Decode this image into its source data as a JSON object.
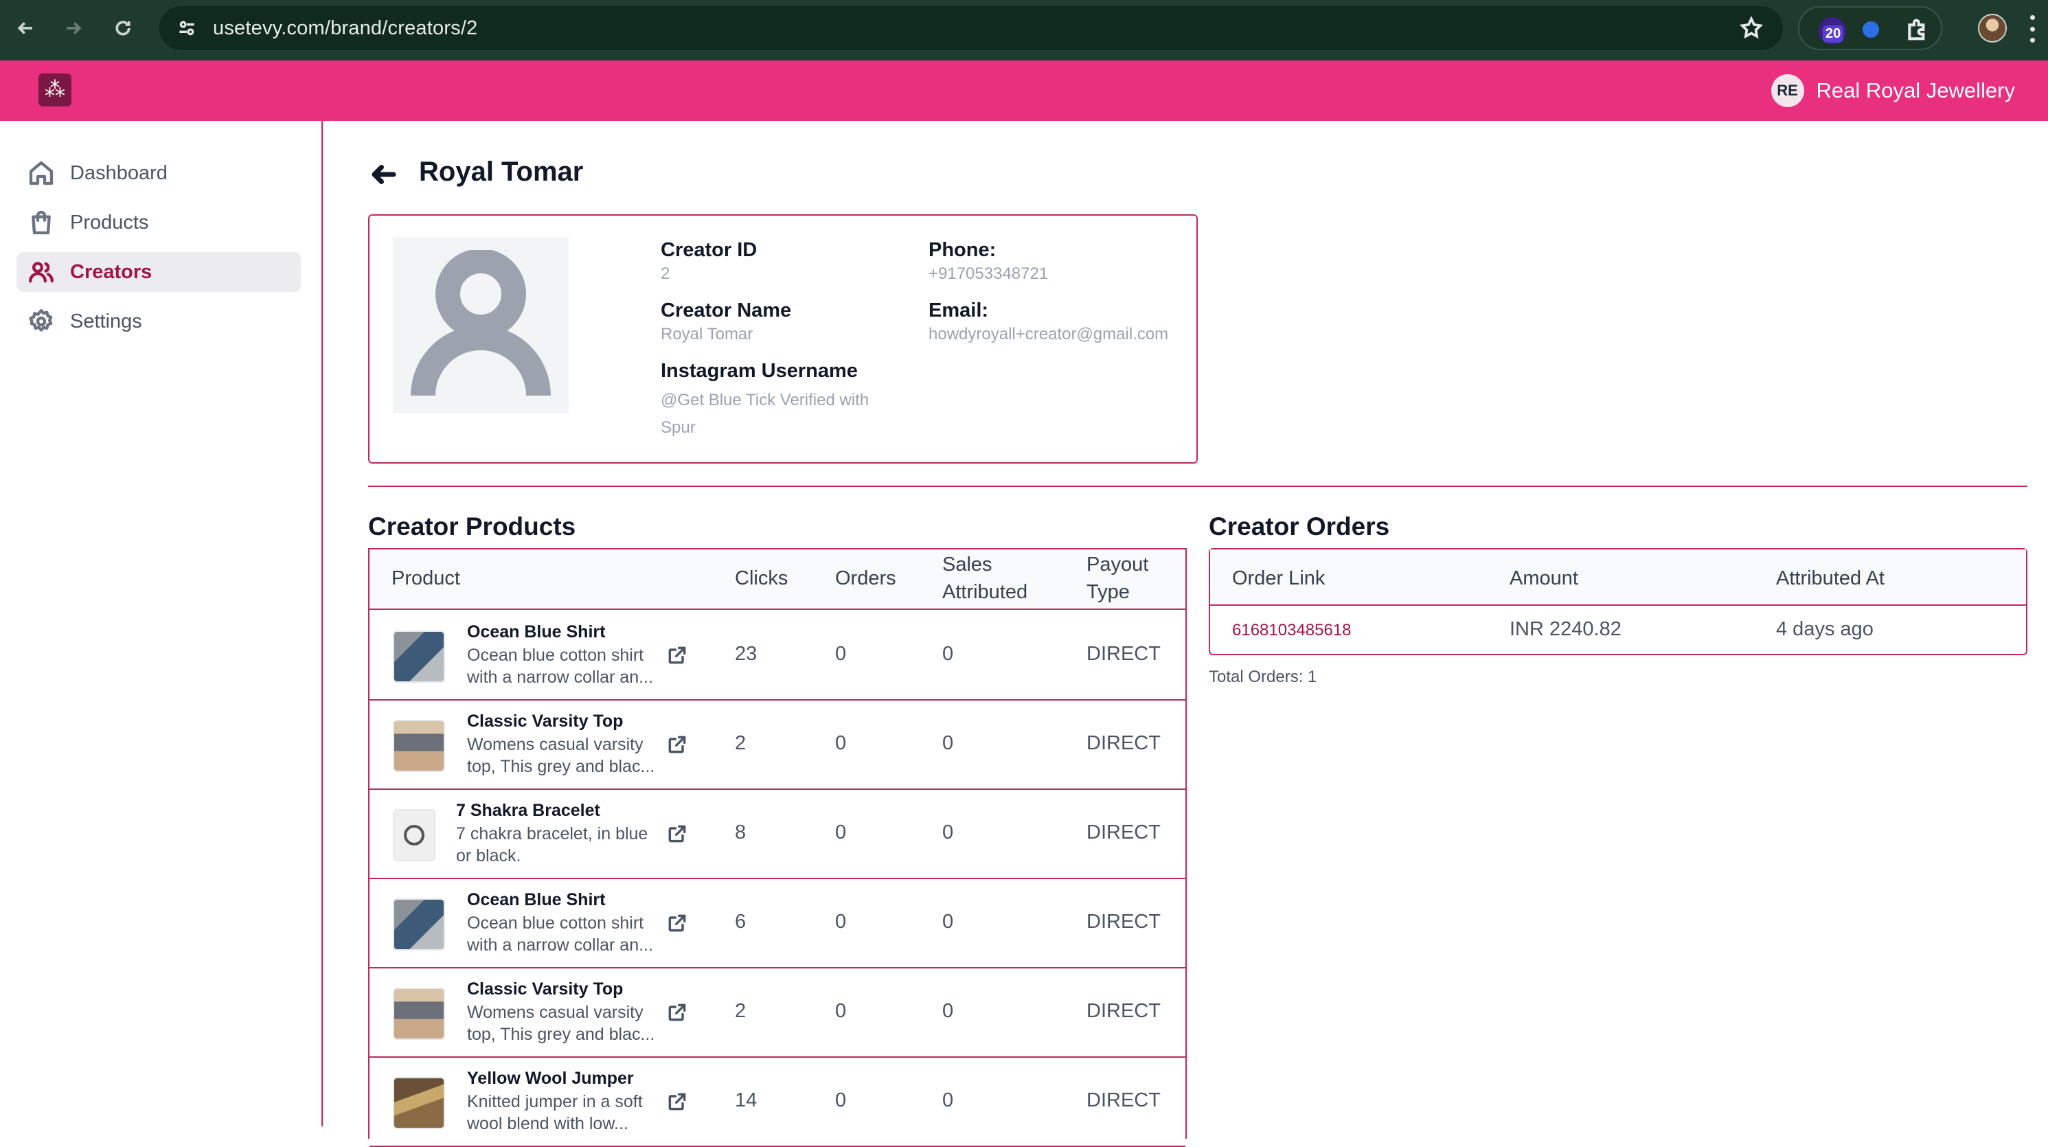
{
  "browser": {
    "url": "usetevy.com/brand/creators/2",
    "extension_badge": "20"
  },
  "header": {
    "logo_glyph": "⁂",
    "brand_initials": "RE",
    "brand_name": "Real Royal Jewellery",
    "accent_color": "#e8307f"
  },
  "sidebar": {
    "items": [
      {
        "label": "Dashboard",
        "icon": "home-icon"
      },
      {
        "label": "Products",
        "icon": "shopping-bag-icon"
      },
      {
        "label": "Creators",
        "icon": "users-icon",
        "active": true
      },
      {
        "label": "Settings",
        "icon": "gear-icon"
      }
    ]
  },
  "page": {
    "title": "Royal Tomar"
  },
  "creator": {
    "id_label": "Creator ID",
    "id_value": "2",
    "name_label": "Creator Name",
    "name_value": "Royal Tomar",
    "instagram_label": "Instagram Username",
    "instagram_value": "@Get Blue Tick Verified with Spur",
    "phone_label": "Phone:",
    "phone_value": "+917053348721",
    "email_label": "Email:",
    "email_value": "howdyroyall+creator@gmail.com"
  },
  "products_section": {
    "title": "Creator Products",
    "columns": {
      "product": "Product",
      "clicks": "Clicks",
      "orders": "Orders",
      "sales": "Sales Attributed",
      "payout": "Payout Type"
    },
    "rows": [
      {
        "name": "Ocean Blue Shirt",
        "desc": "Ocean blue cotton shirt with a narrow collar an...",
        "thumb": "shirt",
        "clicks": "23",
        "orders": "0",
        "sales": "0",
        "payout": "DIRECT"
      },
      {
        "name": "Classic Varsity Top",
        "desc": "Womens casual varsity top, This grey and blac...",
        "thumb": "varsity",
        "clicks": "2",
        "orders": "0",
        "sales": "0",
        "payout": "DIRECT"
      },
      {
        "name": "7 Shakra Bracelet",
        "desc": "7 chakra bracelet, in blue or black.",
        "thumb": "bracelet",
        "clicks": "8",
        "orders": "0",
        "sales": "0",
        "payout": "DIRECT"
      },
      {
        "name": "Ocean Blue Shirt",
        "desc": "Ocean blue cotton shirt with a narrow collar an...",
        "thumb": "shirt",
        "clicks": "6",
        "orders": "0",
        "sales": "0",
        "payout": "DIRECT"
      },
      {
        "name": "Classic Varsity Top",
        "desc": "Womens casual varsity top, This grey and blac...",
        "thumb": "varsity",
        "clicks": "2",
        "orders": "0",
        "sales": "0",
        "payout": "DIRECT"
      },
      {
        "name": "Yellow Wool Jumper",
        "desc": "Knitted jumper in a soft wool blend with low...",
        "thumb": "jumper",
        "clicks": "14",
        "orders": "0",
        "sales": "0",
        "payout": "DIRECT"
      }
    ]
  },
  "orders_section": {
    "title": "Creator Orders",
    "columns": {
      "link": "Order Link",
      "amount": "Amount",
      "attributed": "Attributed At"
    },
    "rows": [
      {
        "link": "6168103485618",
        "amount": "INR 2240.82",
        "attributed": "4 days ago"
      }
    ],
    "total": "Total Orders: 1"
  }
}
